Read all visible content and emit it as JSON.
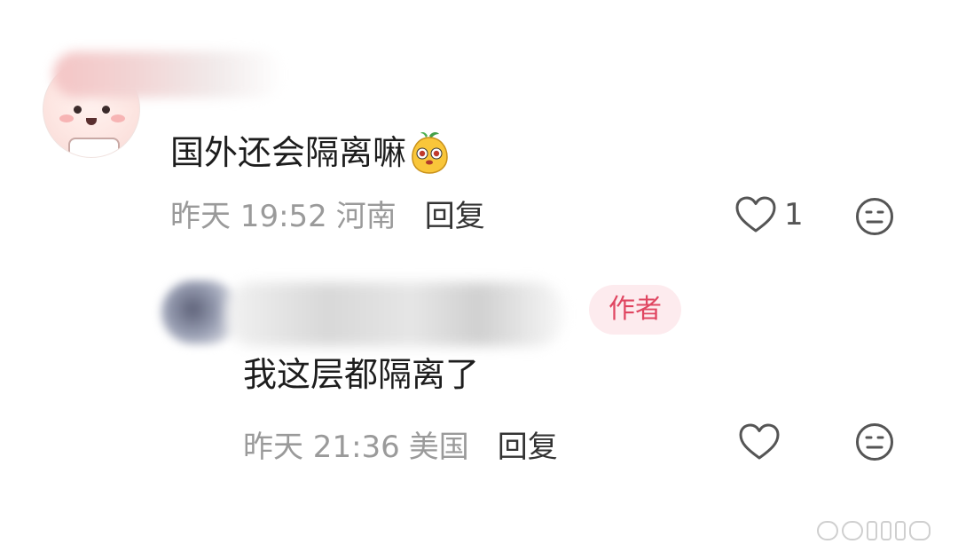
{
  "comment": {
    "text": "国外还会隔离嘛",
    "emoji": "mango-face-emoji",
    "time": "昨天 19:52",
    "location": "河南",
    "reply_label": "回复",
    "like_count": "1"
  },
  "reply": {
    "author_badge": "作者",
    "text": "我这层都隔离了",
    "time": "昨天 21:36",
    "location": "美国",
    "reply_label": "回复"
  },
  "colors": {
    "badge_bg": "#fdebee",
    "badge_text": "#e04661",
    "meta_text": "#9a9a9a"
  },
  "icons": [
    "heart-outline-icon",
    "neutral-face-icon"
  ]
}
